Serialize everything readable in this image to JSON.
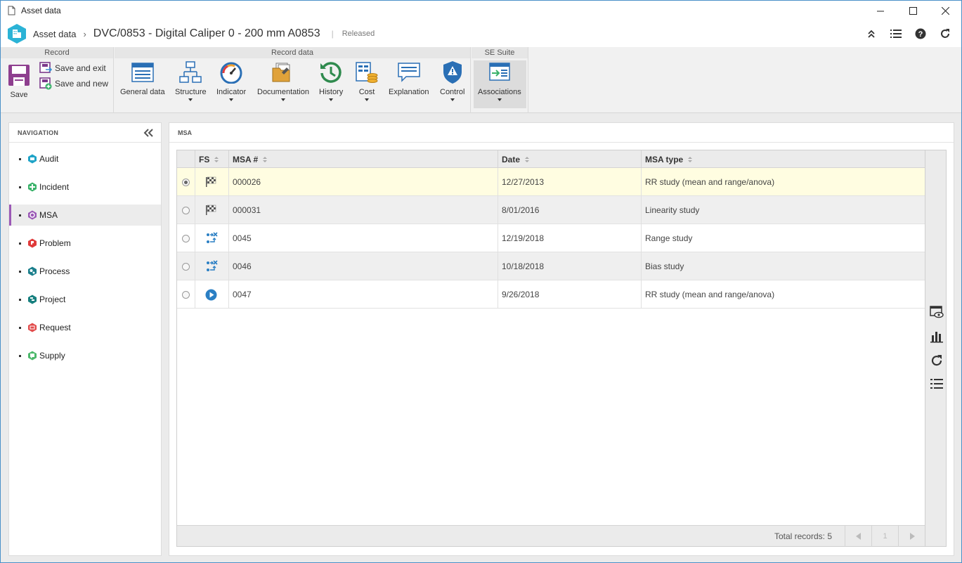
{
  "window": {
    "title": "Asset data"
  },
  "header": {
    "module": "Asset data",
    "record_title": "DVC/0853 - Digital Caliper 0 - 200 mm A0853",
    "separator": "|",
    "status": "Released"
  },
  "ribbon": {
    "groups": {
      "record": "Record",
      "record_data": "Record data",
      "se_suite": "SE Suite"
    },
    "save": "Save",
    "save_exit": "Save and exit",
    "save_new": "Save and new",
    "general_data": "General data",
    "structure": "Structure",
    "indicator": "Indicator",
    "documentation": "Documentation",
    "history": "History",
    "cost": "Cost",
    "explanation": "Explanation",
    "control": "Control",
    "associations": "Associations"
  },
  "navigation": {
    "title": "NAVIGATION",
    "items": [
      {
        "label": "Audit",
        "color": "#1fa3c7"
      },
      {
        "label": "Incident",
        "color": "#3ab26a"
      },
      {
        "label": "MSA",
        "color": "#9b59b6"
      },
      {
        "label": "Problem",
        "color": "#e03b3b"
      },
      {
        "label": "Process",
        "color": "#1b7f8c"
      },
      {
        "label": "Project",
        "color": "#17807f"
      },
      {
        "label": "Request",
        "color": "#e24c4c"
      },
      {
        "label": "Supply",
        "color": "#4cb86b"
      }
    ],
    "active": "MSA"
  },
  "main": {
    "title": "MSA",
    "columns": {
      "fs": "FS",
      "msa": "MSA #",
      "date": "Date",
      "type": "MSA type"
    },
    "rows": [
      {
        "msa": "000026",
        "date": "12/27/2013",
        "type": "RR study (mean and range/anova)",
        "fs_icon": "checkered-flag-icon"
      },
      {
        "msa": "000031",
        "date": "8/01/2016",
        "type": "Linearity study",
        "fs_icon": "checkered-flag-icon"
      },
      {
        "msa": "0045",
        "date": "12/19/2018",
        "type": "Range study",
        "fs_icon": "workflow-cancel-icon"
      },
      {
        "msa": "0046",
        "date": "10/18/2018",
        "type": "Bias study",
        "fs_icon": "workflow-cancel-icon"
      },
      {
        "msa": "0047",
        "date": "9/26/2018",
        "type": "RR study (mean and range/anova)",
        "fs_icon": "play-circle-icon"
      }
    ],
    "total_records": "Total records: 5",
    "page": "1"
  }
}
